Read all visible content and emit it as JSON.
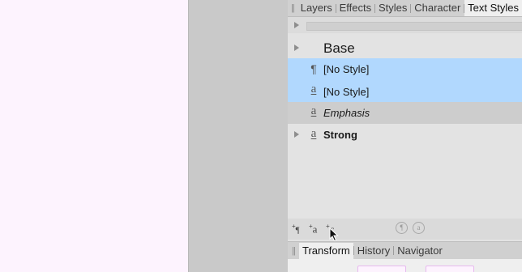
{
  "panel_tabs": {
    "top": [
      "Layers",
      "Effects",
      "Styles",
      "Character",
      "Text Styles"
    ],
    "top_active": "Text Styles",
    "bottom": [
      "Transform",
      "History",
      "Navigator"
    ],
    "bottom_active": "Transform"
  },
  "styles": {
    "group": "Base",
    "items": [
      {
        "glyph": "¶",
        "label": "[No Style]",
        "state": "selected"
      },
      {
        "glyph": "a",
        "label": "[No Style]",
        "state": "selected"
      },
      {
        "glyph": "a",
        "label": "Emphasis",
        "state": "normal"
      },
      {
        "glyph": "a",
        "label": "Strong",
        "state": "normal"
      }
    ]
  },
  "tools": {
    "new_paragraph_style": "¶",
    "new_character_style": "a",
    "new_group_style": "c",
    "plus": "+",
    "para_circle": "¶",
    "char_circle": "a"
  },
  "colors": {
    "selection": "#b1d8fe",
    "canvas": "#fdf3fe"
  }
}
